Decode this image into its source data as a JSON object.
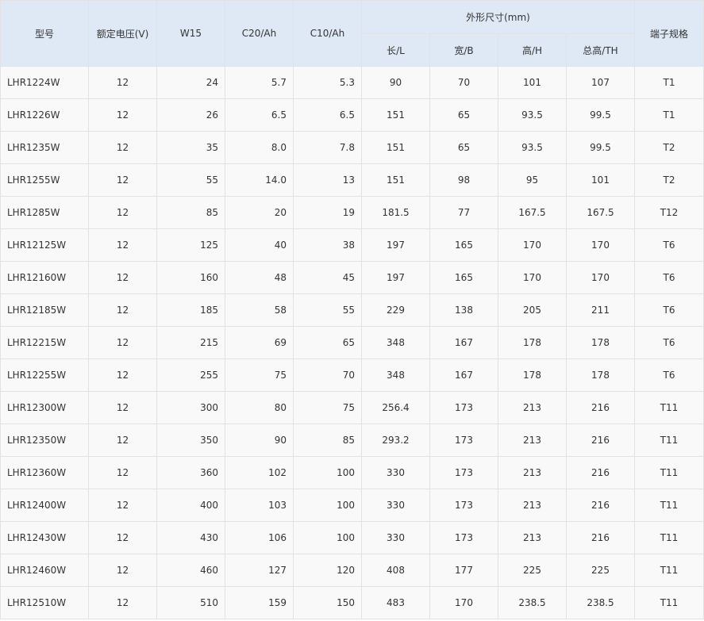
{
  "table": {
    "headers": {
      "model": "型号",
      "voltage": "额定电压(V)",
      "w15": "W15",
      "c20": "C20/Ah",
      "c10": "C10/Ah",
      "dimensions_group": "外形尺寸(mm)",
      "length": "长/L",
      "width": "宽/B",
      "height": "高/H",
      "total_height": "总高/TH",
      "terminal": "端子规格"
    },
    "rows": [
      {
        "model": "LHR1224W",
        "voltage": "12",
        "w15": "24",
        "c20": "5.7",
        "c10": "5.3",
        "length": "90",
        "width": "70",
        "height": "101",
        "total_height": "107",
        "terminal": "T1"
      },
      {
        "model": "LHR1226W",
        "voltage": "12",
        "w15": "26",
        "c20": "6.5",
        "c10": "6.5",
        "length": "151",
        "width": "65",
        "height": "93.5",
        "total_height": "99.5",
        "terminal": "T1"
      },
      {
        "model": "LHR1235W",
        "voltage": "12",
        "w15": "35",
        "c20": "8.0",
        "c10": "7.8",
        "length": "151",
        "width": "65",
        "height": "93.5",
        "total_height": "99.5",
        "terminal": "T2"
      },
      {
        "model": "LHR1255W",
        "voltage": "12",
        "w15": "55",
        "c20": "14.0",
        "c10": "13",
        "length": "151",
        "width": "98",
        "height": "95",
        "total_height": "101",
        "terminal": "T2"
      },
      {
        "model": "LHR1285W",
        "voltage": "12",
        "w15": "85",
        "c20": "20",
        "c10": "19",
        "length": "181.5",
        "width": "77",
        "height": "167.5",
        "total_height": "167.5",
        "terminal": "T12"
      },
      {
        "model": "LHR12125W",
        "voltage": "12",
        "w15": "125",
        "c20": "40",
        "c10": "38",
        "length": "197",
        "width": "165",
        "height": "170",
        "total_height": "170",
        "terminal": "T6"
      },
      {
        "model": "LHR12160W",
        "voltage": "12",
        "w15": "160",
        "c20": "48",
        "c10": "45",
        "length": "197",
        "width": "165",
        "height": "170",
        "total_height": "170",
        "terminal": "T6"
      },
      {
        "model": "LHR12185W",
        "voltage": "12",
        "w15": "185",
        "c20": "58",
        "c10": "55",
        "length": "229",
        "width": "138",
        "height": "205",
        "total_height": "211",
        "terminal": "T6"
      },
      {
        "model": "LHR12215W",
        "voltage": "12",
        "w15": "215",
        "c20": "69",
        "c10": "65",
        "length": "348",
        "width": "167",
        "height": "178",
        "total_height": "178",
        "terminal": "T6"
      },
      {
        "model": "LHR12255W",
        "voltage": "12",
        "w15": "255",
        "c20": "75",
        "c10": "70",
        "length": "348",
        "width": "167",
        "height": "178",
        "total_height": "178",
        "terminal": "T6"
      },
      {
        "model": "LHR12300W",
        "voltage": "12",
        "w15": "300",
        "c20": "80",
        "c10": "75",
        "length": "256.4",
        "width": "173",
        "height": "213",
        "total_height": "216",
        "terminal": "T11"
      },
      {
        "model": "LHR12350W",
        "voltage": "12",
        "w15": "350",
        "c20": "90",
        "c10": "85",
        "length": "293.2",
        "width": "173",
        "height": "213",
        "total_height": "216",
        "terminal": "T11"
      },
      {
        "model": "LHR12360W",
        "voltage": "12",
        "w15": "360",
        "c20": "102",
        "c10": "100",
        "length": "330",
        "width": "173",
        "height": "213",
        "total_height": "216",
        "terminal": "T11"
      },
      {
        "model": "LHR12400W",
        "voltage": "12",
        "w15": "400",
        "c20": "103",
        "c10": "100",
        "length": "330",
        "width": "173",
        "height": "213",
        "total_height": "216",
        "terminal": "T11"
      },
      {
        "model": "LHR12430W",
        "voltage": "12",
        "w15": "430",
        "c20": "106",
        "c10": "100",
        "length": "330",
        "width": "173",
        "height": "213",
        "total_height": "216",
        "terminal": "T11"
      },
      {
        "model": "LHR12460W",
        "voltage": "12",
        "w15": "460",
        "c20": "127",
        "c10": "120",
        "length": "408",
        "width": "177",
        "height": "225",
        "total_height": "225",
        "terminal": "T11"
      },
      {
        "model": "LHR12510W",
        "voltage": "12",
        "w15": "510",
        "c20": "159",
        "c10": "150",
        "length": "483",
        "width": "170",
        "height": "238.5",
        "total_height": "238.5",
        "terminal": "T11"
      }
    ]
  }
}
